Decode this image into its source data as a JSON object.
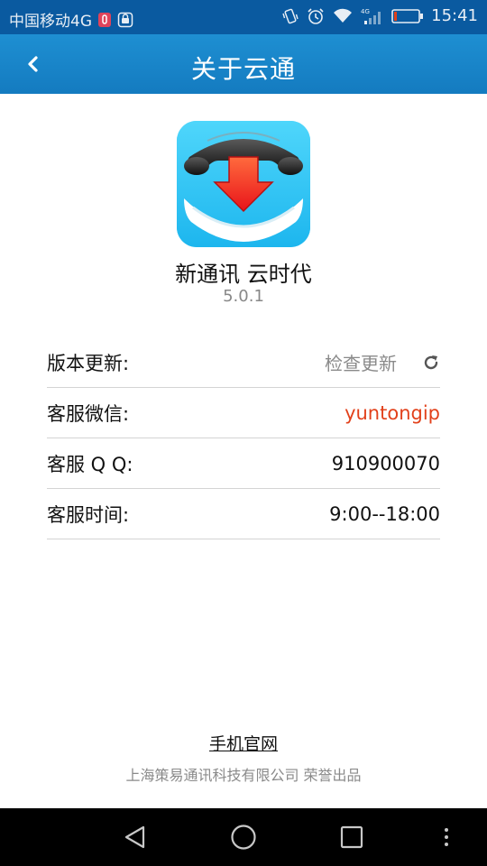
{
  "status_bar": {
    "carrier": "中国移动4G",
    "network_badge": "4G",
    "time": "15:41",
    "icons": [
      "notification-icon",
      "shield-icon",
      "vibrate-icon",
      "alarm-icon",
      "wifi-icon",
      "signal-icon",
      "battery-icon"
    ]
  },
  "header": {
    "title": "关于云通",
    "back_icon": "chevron-left-icon",
    "background": "#1a86c9"
  },
  "app": {
    "name": "新通讯 云时代",
    "version": "5.0.1",
    "icon": "phone-download-icon"
  },
  "info": {
    "update": {
      "label": "版本更新:",
      "value": "检查更新",
      "icon": "refresh-icon"
    },
    "wechat": {
      "label": "客服微信:",
      "value": "yuntongip",
      "color": "#e2411b"
    },
    "qq": {
      "label": "客服 Q Q:",
      "value": "910900070"
    },
    "hours": {
      "label": "客服时间:",
      "value": "9:00--18:00"
    }
  },
  "footer": {
    "website_label": "手机官网",
    "copyright": "上海策易通讯科技有限公司 荣誉出品"
  },
  "nav": {
    "icons": [
      "back-triangle-icon",
      "home-circle-icon",
      "recents-square-icon",
      "more-dots-icon"
    ]
  }
}
